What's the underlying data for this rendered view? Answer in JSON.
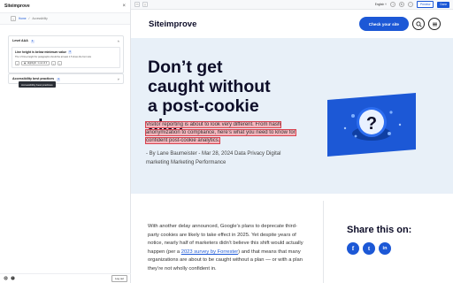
{
  "panel": {
    "title": "Siteimprove",
    "close": "×",
    "breadcrumb": {
      "back": "‹",
      "home": "Home",
      "sep": "/",
      "current": "Accessibility"
    },
    "level_section": {
      "title": "Level AAA",
      "badge": "1",
      "chevron": "˄"
    },
    "issue": {
      "title": "Line height is below minimum value",
      "badge": "4",
      "description": "The 1.5 line-height for paragraphs should be at least 1.5 times the font size",
      "prev": "‹",
      "next": "›",
      "highlight_icon": "◉",
      "highlight_label": "Highlight",
      "highlight_count": "1 out of 4",
      "menu": "⋮"
    },
    "best_section": {
      "title": "Accessibility best practices",
      "badge": "1",
      "chevron": "˅"
    },
    "tooltip": "Accessibility best practices",
    "footer": {
      "logout": "Log out"
    }
  },
  "toolbar": {
    "language": "English",
    "preview": "Preview",
    "done": "Done"
  },
  "site": {
    "logo": "Siteimprove",
    "cta": "Check your site",
    "hero": {
      "title": "Don’t get caught without a post-cookie plan",
      "lead": "Visitor reporting is about to look very different. From hash anonymization to compliance, here’s what you need to know for confident post-cookie analytics.",
      "byline": "- By Lane Baumeister - Mar 28, 2024 Data Privacy Digital marketing Marketing Performance"
    },
    "article": {
      "p1": "With another delay announced, Google’s plans to deprecate third-party cookies are likely to take effect in 2025. Yet despite years of notice, nearly half of marketers didn’t believe this shift would actually happen (per a ",
      "link": "2023 survey by Forrester",
      "p2": ") and that means that many organizations are about to be caught without a plan — or with a plan they’re not wholly confident in."
    },
    "share": {
      "title": "Share this on:",
      "facebook": "f",
      "twitter": "t",
      "linkedin": "in"
    }
  },
  "colors": {
    "brand_blue": "#1c58d6",
    "hero_bg": "#e8f0f8",
    "highlight": "#f4b6bd",
    "highlight_border": "#d8434f",
    "dark_navy": "#0d0d28"
  }
}
